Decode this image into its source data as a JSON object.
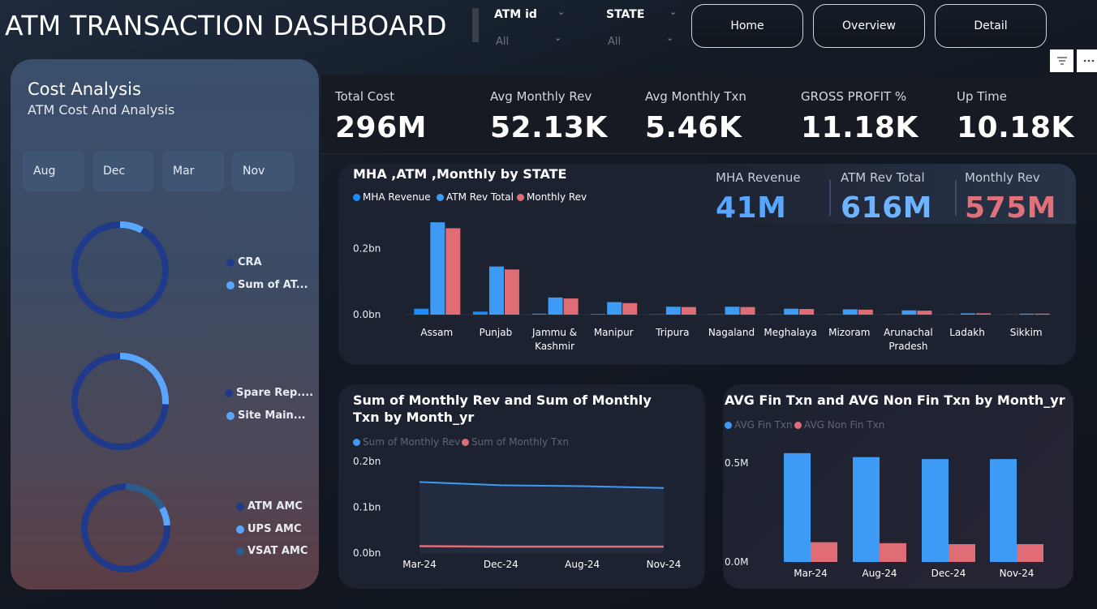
{
  "header": {
    "title": "ATM TRANSACTION DASHBOARD",
    "slicers": [
      {
        "label": "ATM id",
        "value": "All"
      },
      {
        "label": "STATE",
        "value": "All"
      }
    ],
    "nav": {
      "home": "Home",
      "overview": "Overview",
      "detail": "Detail"
    },
    "icons": [
      "filter-icon",
      "more-options-icon"
    ]
  },
  "cost_panel": {
    "title": "Cost Analysis",
    "subtitle": "ATM Cost And Analysis",
    "months": [
      "Aug",
      "Dec",
      "Mar",
      "Nov"
    ],
    "donuts": [
      {
        "legend": [
          {
            "label": "CRA",
            "color": "#1f3a8a"
          },
          {
            "label": "Sum of AT...",
            "color": "#58a6ff"
          }
        ],
        "shares": [
          0.92,
          0.08
        ]
      },
      {
        "legend": [
          {
            "label": "Spare Rep....",
            "color": "#1f3a8a"
          },
          {
            "label": "Site Main...",
            "color": "#58a6ff"
          }
        ],
        "shares": [
          0.74,
          0.26
        ]
      },
      {
        "legend": [
          {
            "label": "ATM AMC",
            "color": "#1f3a8a"
          },
          {
            "label": "UPS AMC",
            "color": "#58a6ff"
          },
          {
            "label": "VSAT AMC",
            "color": "#2b5c8c"
          }
        ],
        "shares": [
          0.76,
          0.07,
          0.17
        ]
      }
    ]
  },
  "kpis": [
    {
      "label": "Total Cost",
      "value": "296M"
    },
    {
      "label": "Avg Monthly Rev",
      "value": "52.13K"
    },
    {
      "label": "Avg Monthly Txn",
      "value": "5.46K"
    },
    {
      "label": "GROSS PROFIT %",
      "value": "11.18K"
    },
    {
      "label": "Up Time",
      "value": "10.18K"
    }
  ],
  "state_card": {
    "mini_kpis": [
      {
        "label": "MHA Revenue",
        "value": "41M",
        "color": "#58a6ff"
      },
      {
        "label": "ATM Rev Total",
        "value": "616M",
        "color": "#6db3ff"
      },
      {
        "label": "Monthly Rev",
        "value": "575M",
        "color": "#e0707a"
      }
    ]
  },
  "colors": {
    "blue": "#3d9bf5",
    "red": "#e06c75",
    "navy": "#1f3a8a"
  },
  "chart_data": [
    {
      "type": "bar",
      "title": "MHA ,ATM ,Monthly by STATE",
      "categories": [
        "Assam",
        "Punjab",
        "Jammu & Kashmir",
        "Manipur",
        "Tripura",
        "Nagaland",
        "Meghalaya",
        "Mizoram",
        "Arunachal Pradesh",
        "Ladakh",
        "Sikkim"
      ],
      "series": [
        {
          "name": "MHA Revenue",
          "color": "#1a8cff",
          "values": [
            0.018,
            0.009,
            0.003,
            0.002,
            0.001,
            0.001,
            0.001,
            0.001,
            0.001,
            0.0005,
            0.0005
          ]
        },
        {
          "name": "ATM Rev Total",
          "color": "#3d9bf5",
          "values": [
            0.28,
            0.146,
            0.052,
            0.038,
            0.024,
            0.024,
            0.018,
            0.016,
            0.013,
            0.004,
            0.003
          ]
        },
        {
          "name": "Monthly Rev",
          "color": "#e06c75",
          "values": [
            0.262,
            0.137,
            0.049,
            0.035,
            0.023,
            0.023,
            0.017,
            0.015,
            0.012,
            0.004,
            0.003
          ]
        }
      ],
      "yticks": [
        "0.0bn",
        "0.2bn"
      ],
      "ylim": [
        0,
        0.3
      ]
    },
    {
      "type": "area",
      "title": "Sum of Monthly Rev and Sum of Monthly Txn by Month_yr",
      "categories": [
        "Mar-24",
        "Dec-24",
        "Aug-24",
        "Nov-24"
      ],
      "series": [
        {
          "name": "Sum of Monthly Rev",
          "color": "#3d9bf5",
          "values": [
            0.155,
            0.148,
            0.146,
            0.142
          ]
        },
        {
          "name": "Sum of Monthly Txn",
          "color": "#e06c75",
          "values": [
            0.015,
            0.014,
            0.014,
            0.014
          ]
        }
      ],
      "yticks": [
        "0.0bn",
        "0.1bn",
        "0.2bn"
      ],
      "ylim": [
        0,
        0.2
      ]
    },
    {
      "type": "bar",
      "title": "AVG Fin Txn and AVG Non Fin Txn by Month_yr",
      "categories": [
        "Mar-24",
        "Aug-24",
        "Dec-24",
        "Nov-24"
      ],
      "series": [
        {
          "name": "AVG Fin Txn",
          "color": "#3d9bf5",
          "values": [
            0.55,
            0.53,
            0.52,
            0.52
          ]
        },
        {
          "name": "AVG Non Fin Txn",
          "color": "#e06c75",
          "values": [
            0.1,
            0.095,
            0.09,
            0.09
          ]
        }
      ],
      "yticks": [
        "0.0M",
        "0.5M"
      ],
      "ylim": [
        0,
        0.5
      ]
    }
  ]
}
